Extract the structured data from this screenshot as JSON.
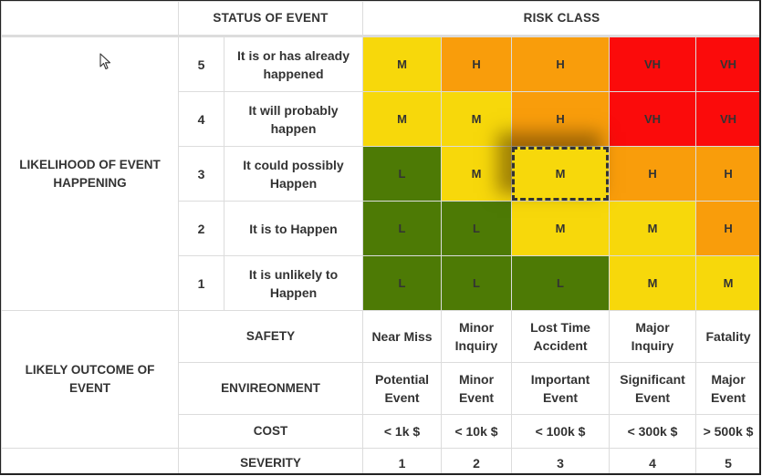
{
  "header": {
    "status_of_event": "STATUS OF EVENT",
    "risk_class": "RISK CLASS"
  },
  "likelihood": {
    "label": "LIKELIHOOD OF EVENT HAPPENING",
    "rows": [
      {
        "level": "5",
        "status": "It is or has already happened",
        "cells": [
          "M",
          "H",
          "H",
          "VH",
          "VH"
        ]
      },
      {
        "level": "4",
        "status": "It will probably happen",
        "cells": [
          "M",
          "M",
          "H",
          "VH",
          "VH"
        ]
      },
      {
        "level": "3",
        "status": "It could possibly Happen",
        "cells": [
          "L",
          "M",
          "M",
          "H",
          "H"
        ]
      },
      {
        "level": "2",
        "status": "It is to Happen",
        "cells": [
          "L",
          "L",
          "M",
          "M",
          "H"
        ]
      },
      {
        "level": "1",
        "status": "It is unlikely to Happen",
        "cells": [
          "L",
          "L",
          "L",
          "M",
          "M"
        ]
      }
    ]
  },
  "selected_cell": {
    "likelihood": "3",
    "severity": "3",
    "value": "M"
  },
  "outcome": {
    "label": "LIKELY OUTCOME OF EVENT",
    "safety": {
      "label": "SAFETY",
      "values": [
        "Near Miss",
        "Minor Inquiry",
        "Lost Time Accident",
        "Major Inquiry",
        "Fatality"
      ]
    },
    "environment": {
      "label": "ENVIREONMENT",
      "values": [
        "Potential Event",
        "Minor Event",
        "Important Event",
        "Significant Event",
        "Major Event"
      ]
    },
    "cost": {
      "label": "COST",
      "values": [
        "< 1k $",
        "< 10k $",
        "< 100k $",
        "< 300k $",
        "> 500k $"
      ]
    }
  },
  "severity": {
    "label": "SEVERITY",
    "values": [
      "1",
      "2",
      "3",
      "4",
      "5"
    ]
  },
  "colors": {
    "L": "#4d7a05",
    "M": "#f7d80b",
    "H": "#f99d0b",
    "VH": "#fb0b0b"
  }
}
